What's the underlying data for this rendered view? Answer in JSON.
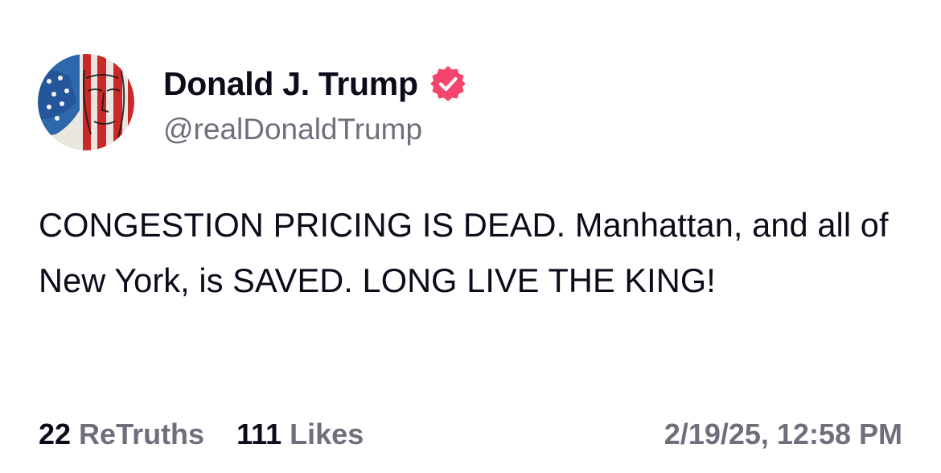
{
  "author": {
    "display_name": "Donald J. Trump",
    "handle": "@realDonaldTrump",
    "verified": true,
    "verified_badge_color": "#f5446e",
    "avatar_icon": "flag-portrait-avatar"
  },
  "post": {
    "text": "CONGESTION PRICING IS DEAD. Manhattan, and all of New York, is SAVED. LONG LIVE THE KING!"
  },
  "stats": {
    "retruths_count": "22",
    "retruths_label": "ReTruths",
    "likes_count": "111",
    "likes_label": "Likes"
  },
  "timestamp": "2/19/25, 12:58 PM",
  "colors": {
    "primary_text": "#0b0b19",
    "secondary_text": "#6f6f7b",
    "background": "#ffffff"
  }
}
